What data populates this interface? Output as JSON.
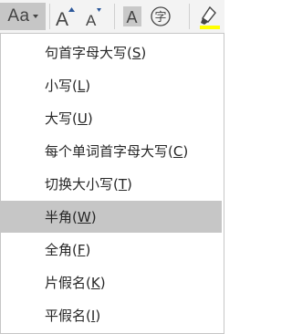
{
  "toolbar": {
    "case_button_label": "Aa",
    "grow_font_glyph": "A",
    "shrink_font_glyph": "A",
    "shading_glyph": "A",
    "enclose_glyph": "字",
    "colors": {
      "ribbon_bg": "#f3f3f3",
      "active_button_bg": "#c6c6c6",
      "icon": "#444444",
      "caret_accent": "#2b579a",
      "highlight_yellow": "#ffff00"
    },
    "icons": [
      "change-case-icon",
      "grow-font-icon",
      "shrink-font-icon",
      "character-shading-icon",
      "enclose-characters-icon",
      "text-highlight-icon"
    ]
  },
  "menu": {
    "items": [
      {
        "label": "句首字母大写",
        "key": "S",
        "selected": false
      },
      {
        "label": "小写",
        "key": "L",
        "selected": false
      },
      {
        "label": "大写",
        "key": "U",
        "selected": false
      },
      {
        "label": "每个单词首字母大写",
        "key": "C",
        "selected": false
      },
      {
        "label": "切换大小写",
        "key": "T",
        "selected": false
      },
      {
        "label": "半角",
        "key": "W",
        "selected": true
      },
      {
        "label": "全角",
        "key": "F",
        "selected": false
      },
      {
        "label": "片假名",
        "key": "K",
        "selected": false
      },
      {
        "label": "平假名",
        "key": "I",
        "selected": false
      }
    ],
    "colors": {
      "text": "#262626",
      "selected_bg": "#c6c6c6",
      "border": "#c6c6c6"
    }
  }
}
